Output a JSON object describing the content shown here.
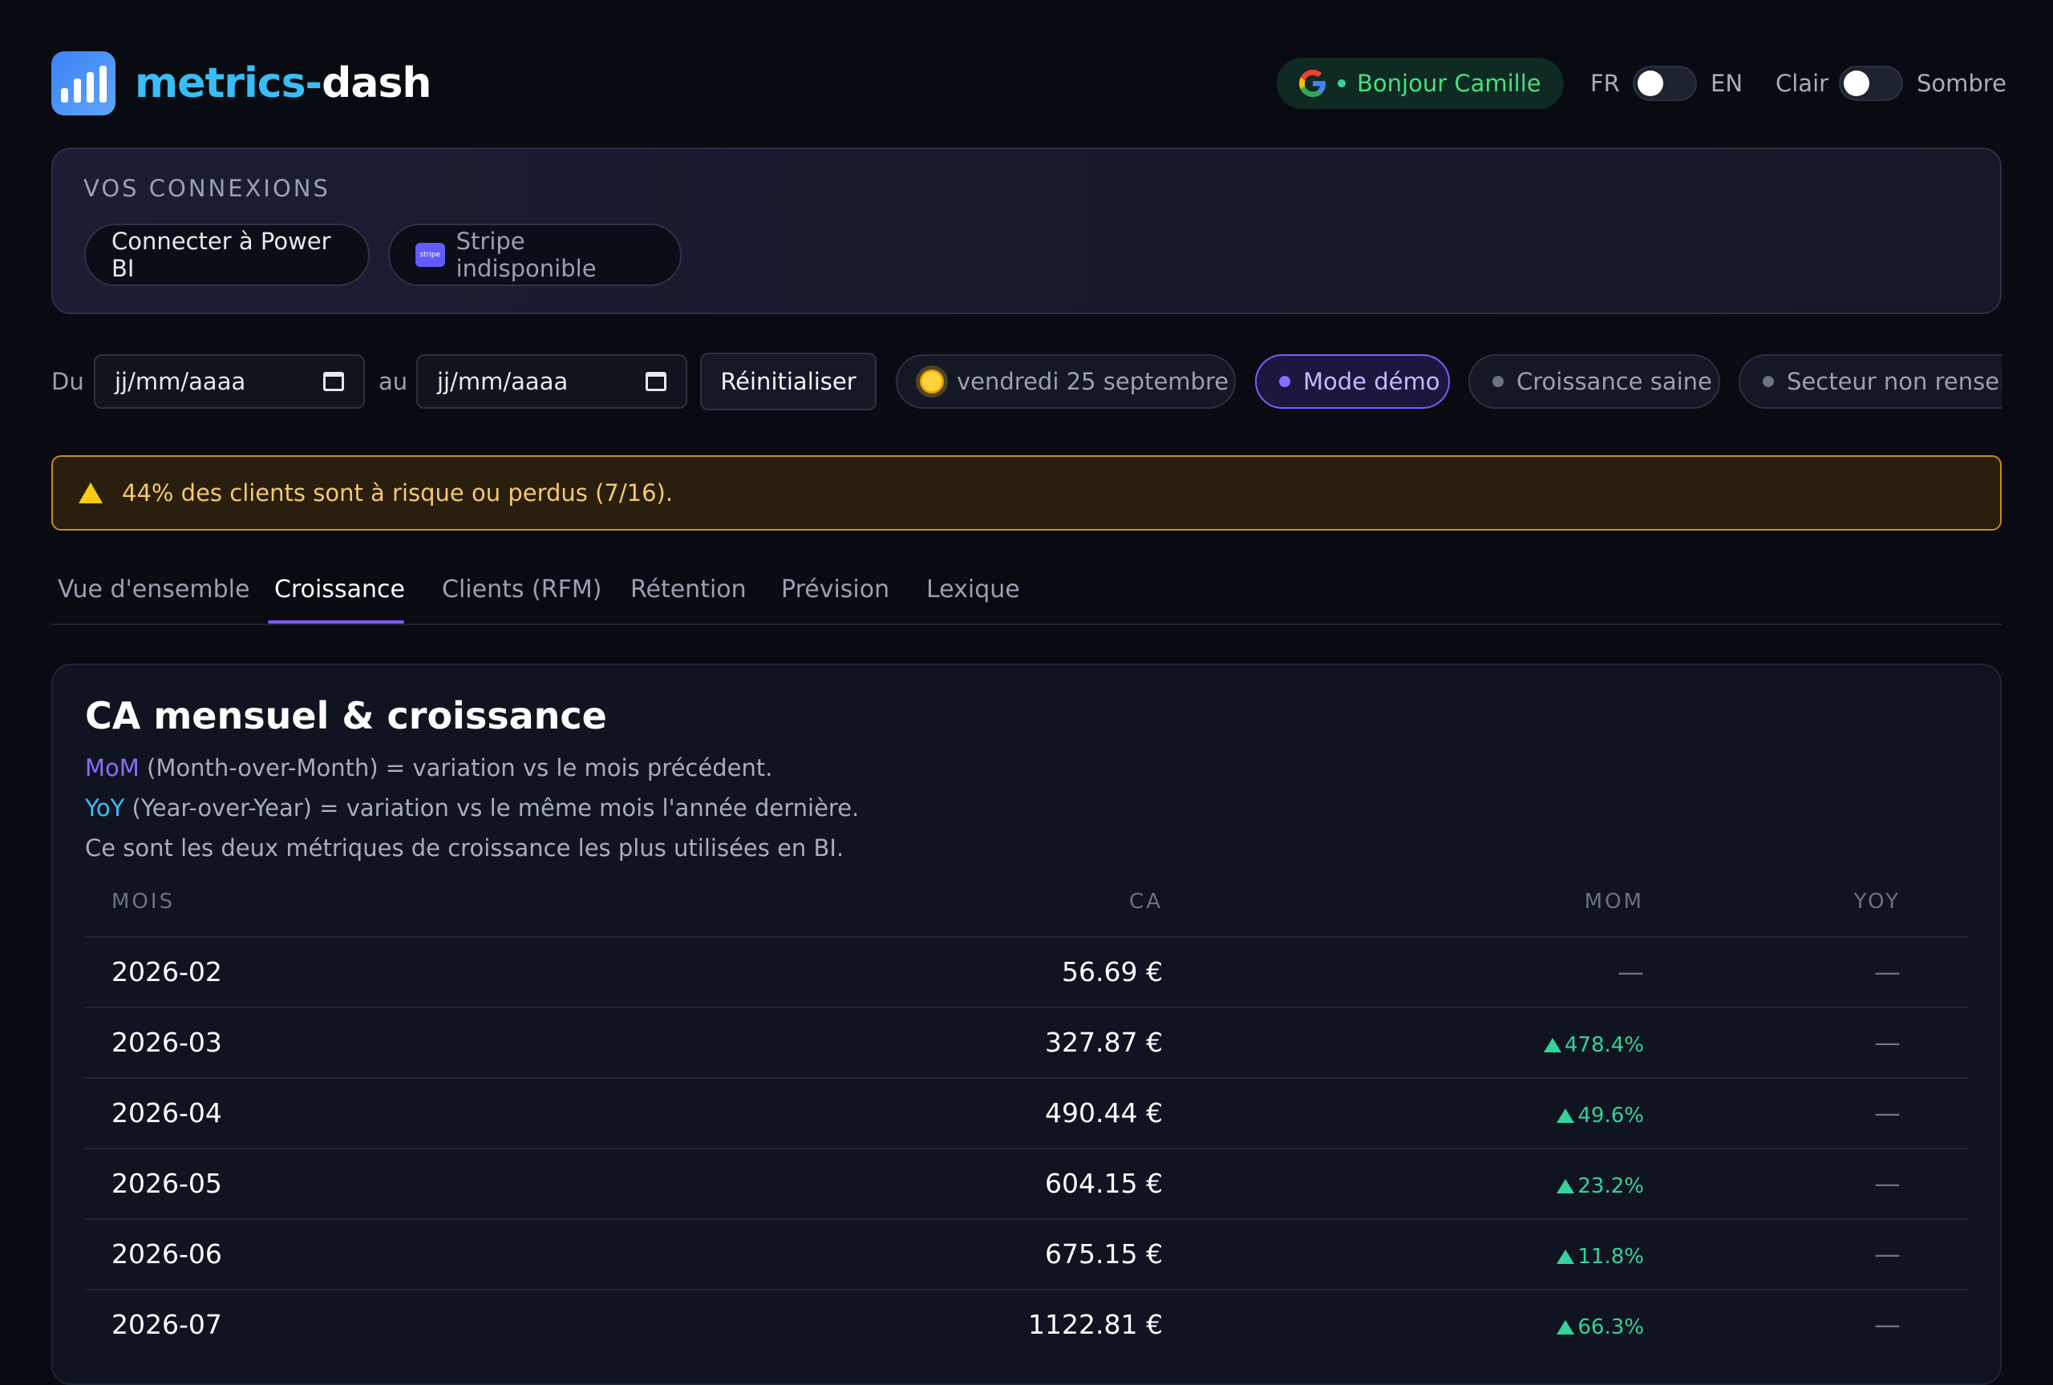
{
  "header": {
    "brand_part1": "metrics-",
    "brand_part2": "dash",
    "greeting": "Bonjour Camille",
    "lang_left": "FR",
    "lang_right": "EN",
    "theme_left": "Clair",
    "theme_right": "Sombre"
  },
  "connections": {
    "title": "VOS CONNEXIONS",
    "powerbi_label": "Connecter à Power BI",
    "stripe_label": "Stripe indisponible",
    "stripe_icon_text": "stripe"
  },
  "filters": {
    "from_label": "Du",
    "to_label": "au",
    "from_placeholder": "jj/mm/aaaa",
    "to_placeholder": "jj/mm/aaaa",
    "reset_label": "Réinitialiser",
    "chips": {
      "date": "vendredi 25 septembre",
      "demo": "Mode démo",
      "growth": "Croissance saine",
      "sector": "Secteur non renseigné"
    }
  },
  "alert": {
    "text": "44% des clients sont à risque ou perdus (7/16)."
  },
  "tabs": [
    "Vue d'ensemble",
    "Croissance",
    "Clients (RFM)",
    "Rétention",
    "Prévision",
    "Lexique"
  ],
  "active_tab": "Croissance",
  "card": {
    "title": "CA mensuel & croissance",
    "mom_term": "MoM",
    "mom_desc": " (Month-over-Month) = variation vs le mois précédent.",
    "yoy_term": "YoY",
    "yoy_desc": " (Year-over-Year) = variation vs le même mois l'année dernière.",
    "note": "Ce sont les deux métriques de croissance les plus utilisées en BI.",
    "columns": [
      "MOIS",
      "CA",
      "MOM",
      "YOY"
    ],
    "rows": [
      {
        "mois": "2026-02",
        "ca": "56.69 €",
        "mom": "—",
        "yoy": "—"
      },
      {
        "mois": "2026-03",
        "ca": "327.87 €",
        "mom": "478.4%",
        "yoy": "—"
      },
      {
        "mois": "2026-04",
        "ca": "490.44 €",
        "mom": "49.6%",
        "yoy": "—"
      },
      {
        "mois": "2026-05",
        "ca": "604.15 €",
        "mom": "23.2%",
        "yoy": "—"
      },
      {
        "mois": "2026-06",
        "ca": "675.15 €",
        "mom": "11.8%",
        "yoy": "—"
      },
      {
        "mois": "2026-07",
        "ca": "1122.81 €",
        "mom": "66.3%",
        "yoy": "—"
      }
    ]
  },
  "colors": {
    "accent_purple": "#7c5cff",
    "accent_blue": "#38bdf8",
    "positive": "#34d399",
    "warning": "#facc15"
  }
}
